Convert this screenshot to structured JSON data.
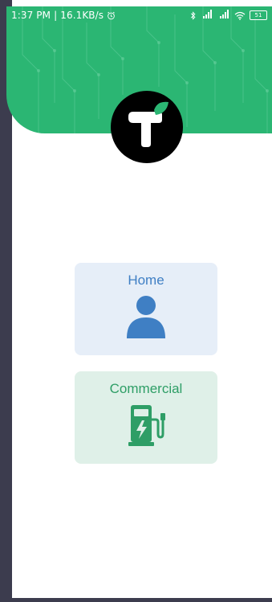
{
  "status_bar": {
    "time": "1:37 PM",
    "separator": "|",
    "speed": "16.1KB/s",
    "alarm_icon": "alarm-clock-icon",
    "bluetooth_icon": "bluetooth-icon",
    "signal1": "4G",
    "signal2": "4G",
    "wifi_icon": "wifi-icon",
    "battery": "51"
  },
  "logo": {
    "icon": "brand-logo-icon",
    "colors": {
      "background": "#000000",
      "letter": "#ffffff",
      "leaf": "#2bb673"
    }
  },
  "header": {
    "color": "#2bb673"
  },
  "options": [
    {
      "label": "Home",
      "icon": "person-icon",
      "color": "#3f7fc4",
      "bg": "#e6eef8"
    },
    {
      "label": "Commercial",
      "icon": "ev-charger-icon",
      "color": "#2e9e66",
      "bg": "#dff0e8"
    }
  ]
}
